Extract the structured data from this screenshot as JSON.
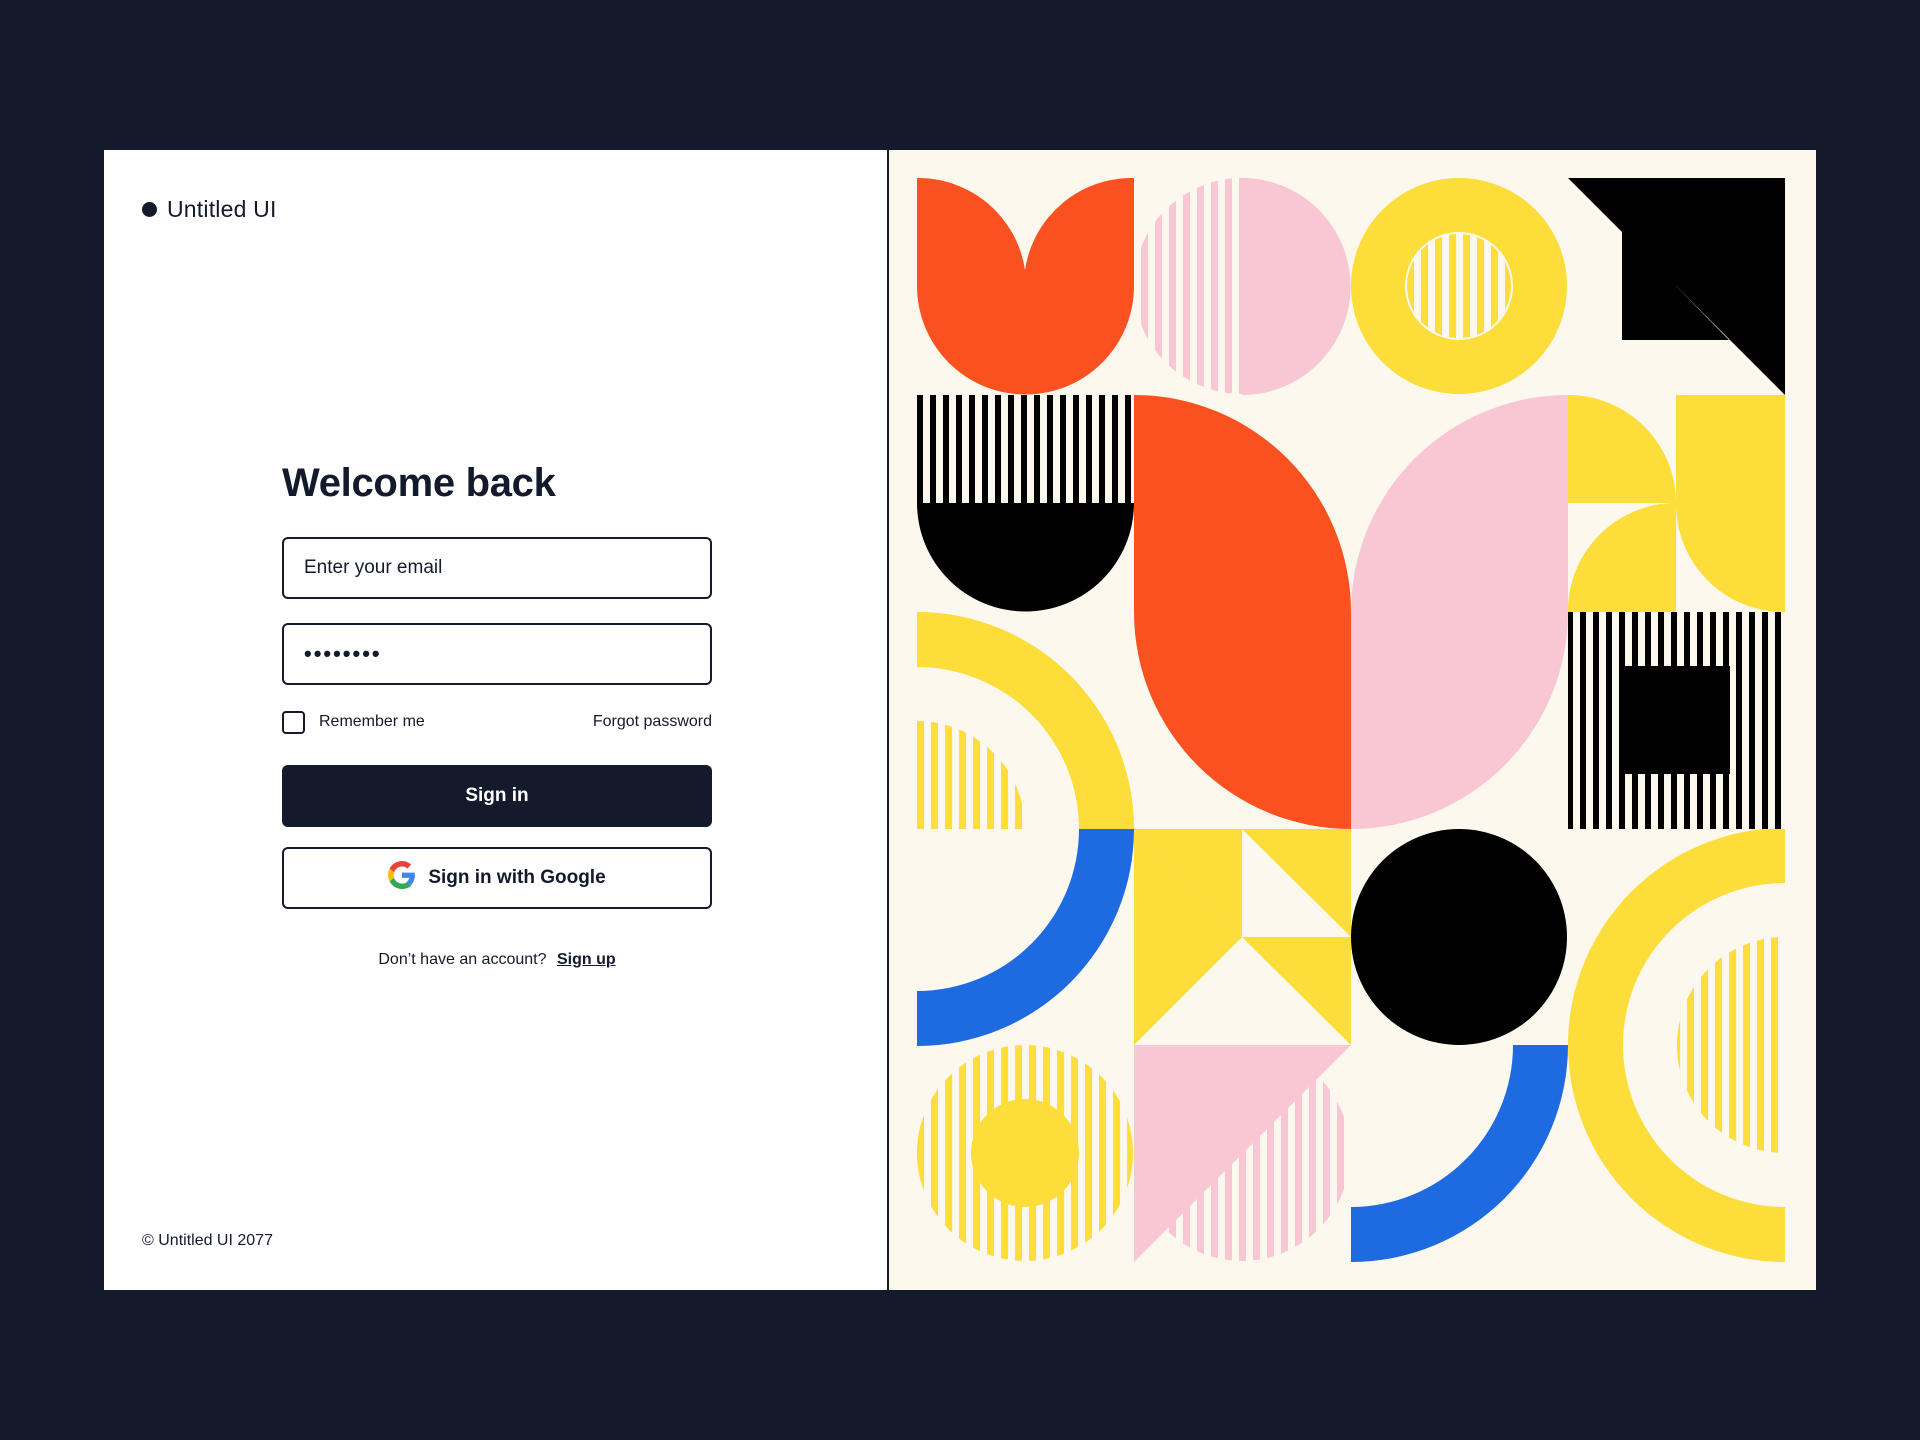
{
  "brand": {
    "name": "Untitled UI"
  },
  "login": {
    "title": "Welcome back",
    "email_placeholder": "Enter your email",
    "password_value": "••••••••",
    "remember_label": "Remember me",
    "forgot_label": "Forgot password",
    "signin_label": "Sign in",
    "google_label": "Sign in with Google",
    "no_account_text": "Don’t have an account?",
    "signup_label": "Sign up"
  },
  "footer": {
    "copyright": "© Untitled UI 2077"
  },
  "colors": {
    "background": "#131a2b",
    "ink": "#131a2b",
    "art_cream": "#fdf8ee",
    "art_orange": "#fb5121",
    "art_pink": "#f9c6d3",
    "art_yellow": "#fcdd3a",
    "art_blue": "#1e6ae1",
    "art_black": "#000000"
  },
  "icons": {
    "brand": "dot-icon",
    "google": "google-g-icon"
  },
  "artwork": {
    "description_name": "geometric-bauhaus-pattern"
  }
}
